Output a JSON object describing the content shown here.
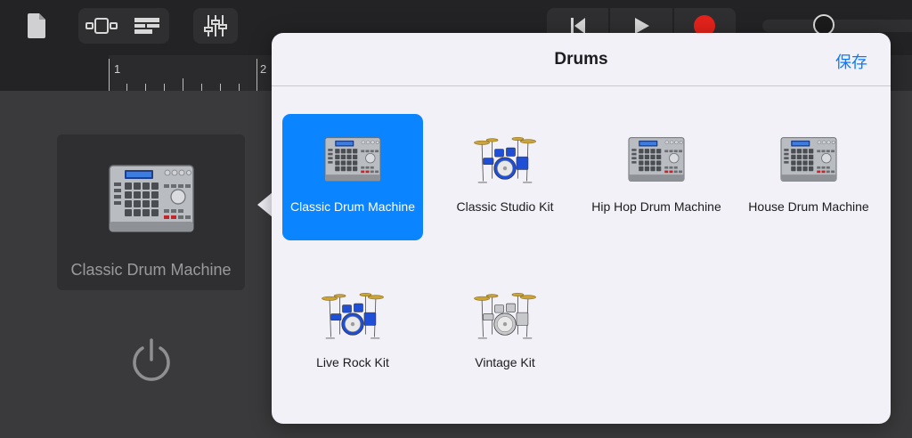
{
  "colors": {
    "accent": "#0a84ff",
    "save_link": "#0a7aff",
    "record": "#e5221b",
    "popover_bg": "#f2f1f7",
    "dark_bg": "#1c1c1e"
  },
  "toolbar": {
    "icons": [
      "document-icon",
      "tracks-view-icon",
      "live-loops-icon",
      "mixer-sliders-icon",
      "rewind-to-start-icon",
      "play-icon",
      "record-icon"
    ]
  },
  "ruler": {
    "bar_numbers": [
      "1",
      "2"
    ]
  },
  "instrument": {
    "name": "Classic Drum Machine",
    "power_icon": "power-icon"
  },
  "popover": {
    "title": "Drums",
    "save_label": "保存",
    "items": [
      {
        "label": "Classic Drum Machine",
        "icon": "drum-machine-icon",
        "selected": true
      },
      {
        "label": "Classic Studio Kit",
        "icon": "drum-kit-blue-icon",
        "selected": false
      },
      {
        "label": "Hip Hop Drum Machine",
        "icon": "drum-machine-icon",
        "selected": false
      },
      {
        "label": "House Drum Machine",
        "icon": "drum-machine-icon",
        "selected": false
      },
      {
        "label": "Live Rock Kit",
        "icon": "drum-kit-blue-icon",
        "selected": false
      },
      {
        "label": "Vintage Kit",
        "icon": "drum-kit-silver-icon",
        "selected": false
      }
    ]
  }
}
